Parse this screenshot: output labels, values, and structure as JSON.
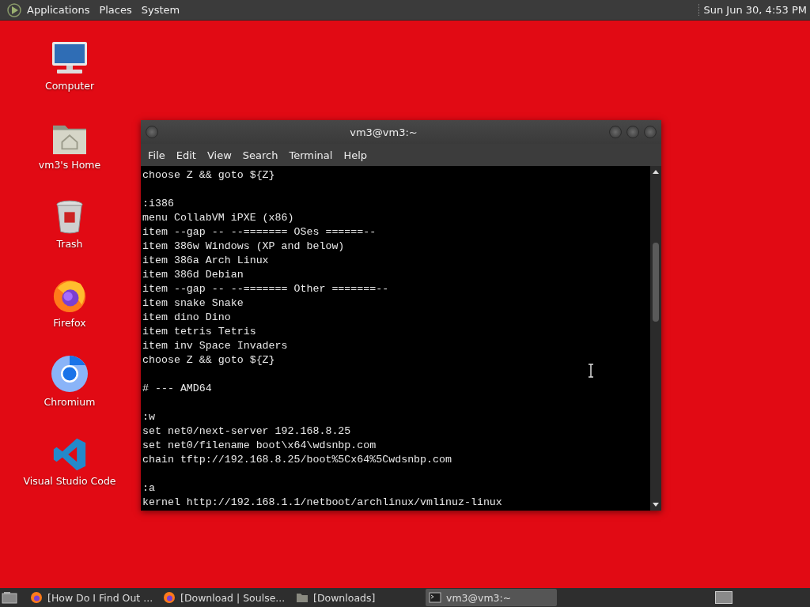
{
  "top_panel": {
    "menus": [
      "Applications",
      "Places",
      "System"
    ],
    "clock": "Sun Jun 30, 4:53 PM"
  },
  "desktop_icons": [
    {
      "label": "Computer",
      "kind": "computer"
    },
    {
      "label": "vm3's Home",
      "kind": "home"
    },
    {
      "label": "Trash",
      "kind": "trash"
    },
    {
      "label": "Firefox",
      "kind": "firefox"
    },
    {
      "label": "Chromium",
      "kind": "chromium"
    },
    {
      "label": "Visual Studio Code",
      "kind": "vscode"
    }
  ],
  "terminal": {
    "title": "vm3@vm3:~",
    "menu": [
      "File",
      "Edit",
      "View",
      "Search",
      "Terminal",
      "Help"
    ],
    "blocks": [
      [
        "choose Z && goto ${Z}"
      ],
      [
        ":i386",
        "menu CollabVM iPXE (x86)",
        "item --gap -- --======= OSes ======--",
        "item 386w Windows (XP and below)",
        "item 386a Arch Linux",
        "item 386d Debian",
        "item --gap -- --======= Other =======--",
        "item snake Snake",
        "item dino Dino",
        "item tetris Tetris",
        "item inv Space Invaders",
        "choose Z && goto ${Z}"
      ],
      [
        "# --- AMD64"
      ],
      [
        ":w",
        "set net0/next-server 192.168.8.25",
        "set net0/filename boot\\x64\\wdsnbp.com",
        "chain tftp://192.168.8.25/boot%5Cx64%5Cwdsnbp.com"
      ],
      [
        ":a",
        "kernel http://192.168.1.1/netboot/archlinux/vmlinuz-linux"
      ]
    ]
  },
  "taskbar": {
    "items": [
      {
        "label": "[How Do I Find Out ...",
        "kind": "firefox",
        "selected": false
      },
      {
        "label": "[Download | Soulse...",
        "kind": "firefox",
        "selected": false
      },
      {
        "label": "[Downloads]",
        "kind": "folder",
        "selected": false
      },
      {
        "label": "vm3@vm3:~",
        "kind": "terminal",
        "selected": true
      }
    ]
  }
}
